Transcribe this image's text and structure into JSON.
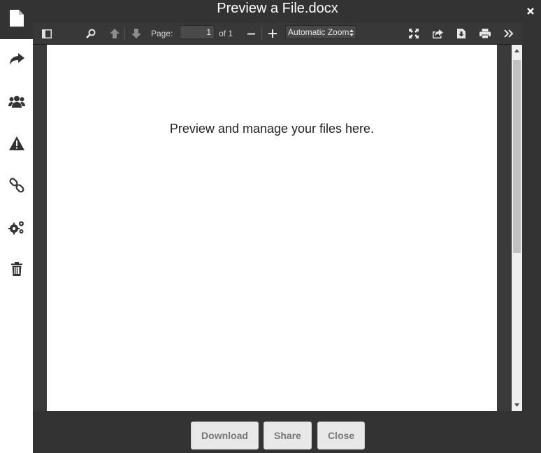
{
  "dialog": {
    "title": "Preview a File.docx"
  },
  "toolbar": {
    "page_label": "Page:",
    "page_value": "1",
    "page_of": "of 1",
    "zoom_value": "Automatic Zoom"
  },
  "document": {
    "text": "Preview and manage your files here."
  },
  "footer": {
    "download_label": "Download",
    "share_label": "Share",
    "close_label": "Close"
  },
  "sidebar": {
    "icons": [
      "file-icon",
      "share-arrow-icon",
      "users-icon",
      "warning-icon",
      "link-icon",
      "gears-icon",
      "trash-icon"
    ]
  },
  "colors": {
    "modal_bg": "#333333",
    "toolbar_bg": "#383838",
    "page_bg": "#ffffff",
    "button_bg": "#e8e8e8",
    "button_text": "#777777"
  }
}
